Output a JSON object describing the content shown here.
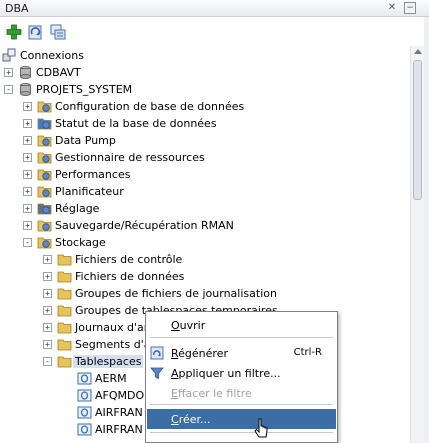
{
  "window": {
    "title": "DBA"
  },
  "toolbar": {
    "buttons": [
      {
        "name": "add-connection-button",
        "icon": "green-plus-icon"
      },
      {
        "name": "refresh-button",
        "icon": "refresh-icon"
      },
      {
        "name": "filter-button",
        "icon": "copy-icon"
      }
    ]
  },
  "tree": {
    "items": [
      {
        "label": "Connexions",
        "icon": "connections-icon",
        "level": 0,
        "expander": ""
      },
      {
        "label": "CDBAVT",
        "icon": "database-icon",
        "level": 1,
        "expander": "+"
      },
      {
        "label": "PROJETS_SYSTEM",
        "icon": "database-icon",
        "level": 1,
        "expander": "−"
      },
      {
        "label": "Configuration de base de données",
        "icon": "folder-config-icon",
        "level": 2,
        "expander": "+"
      },
      {
        "label": "Statut de la base de données",
        "icon": "status-icon",
        "level": 2,
        "expander": "+"
      },
      {
        "label": "Data Pump",
        "icon": "datapump-icon",
        "level": 2,
        "expander": "+"
      },
      {
        "label": "Gestionnaire de ressources",
        "icon": "resource-icon",
        "level": 2,
        "expander": "+"
      },
      {
        "label": "Performances",
        "icon": "performance-icon",
        "level": 2,
        "expander": "+"
      },
      {
        "label": "Planificateur",
        "icon": "scheduler-icon",
        "level": 2,
        "expander": "+"
      },
      {
        "label": "Réglage",
        "icon": "tuning-icon",
        "level": 2,
        "expander": "+"
      },
      {
        "label": "Sauvegarde/Récupération RMAN",
        "icon": "rman-icon",
        "level": 2,
        "expander": "+"
      },
      {
        "label": "Stockage",
        "icon": "storage-icon",
        "level": 2,
        "expander": "−"
      },
      {
        "label": "Fichiers de contrôle",
        "icon": "folder-icon",
        "level": 3,
        "expander": "+"
      },
      {
        "label": "Fichiers de données",
        "icon": "folder-icon",
        "level": 3,
        "expander": "+"
      },
      {
        "label": "Groupes de fichiers de journalisation",
        "icon": "folder-icon",
        "level": 3,
        "expander": "+"
      },
      {
        "label": "Groupes de tablespaces temporaires",
        "icon": "folder-icon",
        "level": 3,
        "expander": "+"
      },
      {
        "label": "Journaux d'ar",
        "icon": "folder-icon",
        "level": 3,
        "expander": "+"
      },
      {
        "label": "Segments d'a",
        "icon": "folder-icon",
        "level": 3,
        "expander": "+"
      },
      {
        "label": "Tablespaces",
        "icon": "folder-icon",
        "level": 3,
        "expander": "−",
        "selected": true
      },
      {
        "label": "AERM",
        "icon": "tablespace-icon",
        "level": 4,
        "expander": ""
      },
      {
        "label": "AFQMDO",
        "icon": "tablespace-icon",
        "level": 4,
        "expander": ""
      },
      {
        "label": "AIRFRAN",
        "icon": "tablespace-icon",
        "level": 4,
        "expander": ""
      },
      {
        "label": "AIRFRAN",
        "icon": "tablespace-icon",
        "level": 4,
        "expander": ""
      }
    ]
  },
  "context_menu": {
    "items": [
      {
        "label": "Ouvrir",
        "mnemonic": "O",
        "rest": "uvrir",
        "accelerator": "",
        "icon": "",
        "enabled": true
      },
      {
        "label": "Régénérer",
        "mnemonic": "R",
        "rest": "égénérer",
        "accelerator": "Ctrl-R",
        "icon": "refresh-icon",
        "enabled": true
      },
      {
        "label": "Appliquer un filtre...",
        "mnemonic": "A",
        "rest": "ppliquer un filtre...",
        "accelerator": "",
        "icon": "filter-icon",
        "enabled": true
      },
      {
        "label": "Effacer le filtre",
        "mnemonic": "E",
        "rest": "ffacer le filtre",
        "accelerator": "",
        "icon": "",
        "enabled": false
      },
      {
        "label": "Créer...",
        "mnemonic": "C",
        "rest": "réer...",
        "accelerator": "",
        "icon": "",
        "enabled": true,
        "highlighted": true
      }
    ]
  },
  "colors": {
    "highlight": "#3a6ea5",
    "selection": "#d6dff0",
    "disabled": "#a0a0a0"
  }
}
